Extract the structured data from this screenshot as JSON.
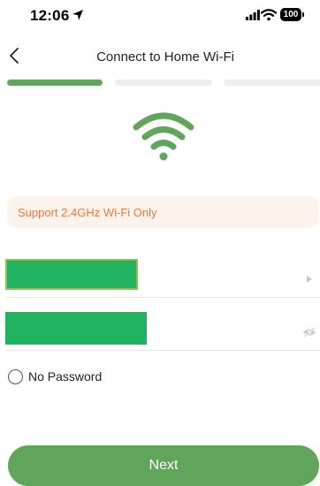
{
  "status_bar": {
    "time": "12:06",
    "battery": "100"
  },
  "header": {
    "title": "Connect to Home Wi-Fi"
  },
  "progress": {
    "steps_total": 3,
    "current_step": 1,
    "active_color": "#5fa65a",
    "inactive_color": "#eeeeee"
  },
  "notice": {
    "text": "Support 2.4GHz Wi-Fi Only",
    "text_color": "#e07a3a",
    "background": "#fdf3ed"
  },
  "form": {
    "ssid_value": "",
    "password_value": "",
    "no_password_label": "No Password",
    "no_password_checked": false,
    "redaction_color": "#21b35f"
  },
  "actions": {
    "next_label": "Next"
  },
  "icons": {
    "back": "chevron-left-icon",
    "wifi": "wifi-icon",
    "ssid_select": "caret-right-icon",
    "password_toggle": "eye-hidden-icon"
  }
}
